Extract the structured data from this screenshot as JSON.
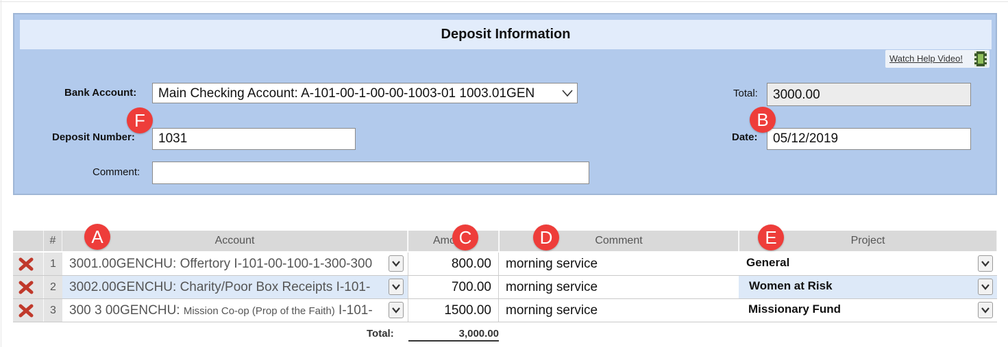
{
  "deposit": {
    "title": "Deposit Information",
    "help_link": "Watch Help Video!",
    "bank_account_label": "Bank Account:",
    "bank_account_value": "Main Checking Account: A-101-00-1-00-00-1003-01 1003.01GEN",
    "deposit_number_label": "Deposit Number:",
    "deposit_number_value": "1031",
    "comment_label": "Comment:",
    "comment_value": "",
    "total_label": "Total:",
    "total_value": "3000.00",
    "date_label": "Date:",
    "date_value": "05/12/2019"
  },
  "markers": {
    "a": "A",
    "b": "B",
    "c": "C",
    "d": "D",
    "e": "E",
    "f": "F"
  },
  "grid": {
    "headers": {
      "num": "#",
      "account": "Account",
      "amount": "Amo",
      "comment": "Comment",
      "project": "Project"
    },
    "rows": [
      {
        "num": "1",
        "account_main": "3001.00GENCHU: Offertory I-101-00-100-1-300-300",
        "account_small": "",
        "account_tail": "",
        "amount": "800.00",
        "comment": "morning service",
        "project": "General"
      },
      {
        "num": "2",
        "account_main": "3002.00GENCHU: Charity/Poor Box Receipts I-101-",
        "account_small": "",
        "account_tail": "",
        "amount": "700.00",
        "comment": "morning service",
        "project": "Women at Risk"
      },
      {
        "num": "3",
        "account_main": "300 3 00GENCHU: ",
        "account_small": "Mission Co-op (Prop of the Faith)",
        "account_tail": " I-101-",
        "amount": "1500.00",
        "comment": "morning service",
        "project": "Missionary Fund"
      }
    ],
    "total_label": "Total:",
    "total_value": "3,000.00"
  },
  "colors": {
    "panel_bg": "#b2caec",
    "header_bg": "#e2ecfb",
    "marker_red": "#ee3d3a",
    "delete_red": "#c0392b",
    "row_highlight": "#dde9f8"
  },
  "icons": {
    "help": "film-strip-icon",
    "delete": "x-delete-icon",
    "dropdown": "chevron-down-icon"
  }
}
